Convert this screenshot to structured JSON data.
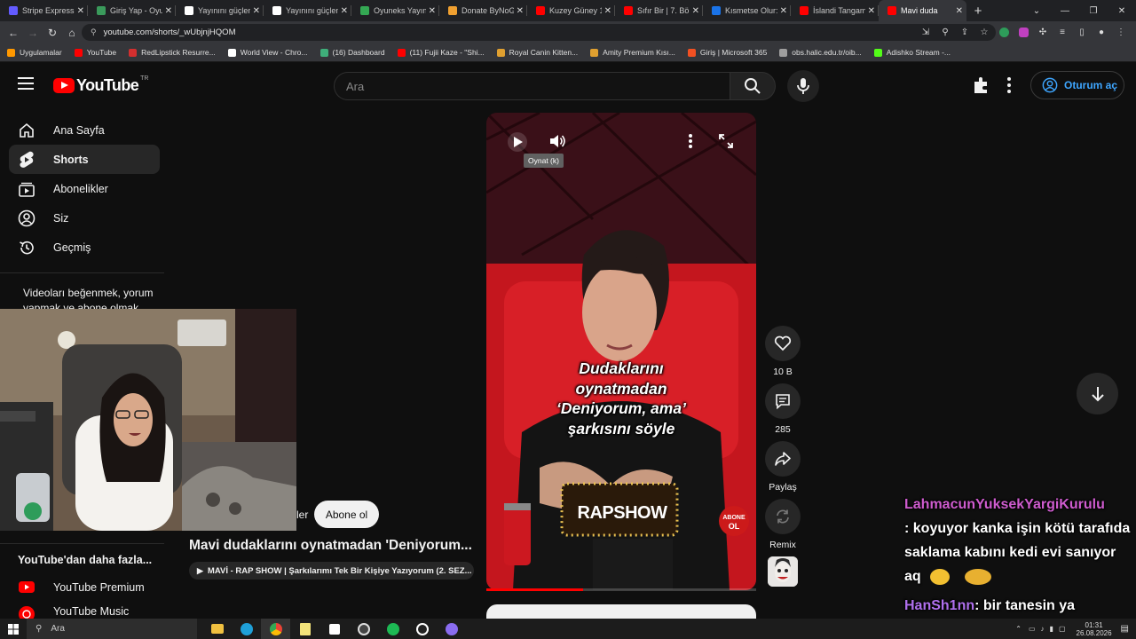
{
  "browser": {
    "tabs": [
      {
        "title": "Stripe Express",
        "color": "#635bff"
      },
      {
        "title": "Giriş Yap - Oyun",
        "color": "#3a9a5b"
      },
      {
        "title": "Yayınını güçlend",
        "color": "#ffffff"
      },
      {
        "title": "Yayınını güçlend",
        "color": "#ffffff"
      },
      {
        "title": "Oyuneks Yayınc",
        "color": "#34a853"
      },
      {
        "title": "Donate ByNoGa",
        "color": "#f0a030"
      },
      {
        "title": "Kuzey Güney 11",
        "color": "#ff0000"
      },
      {
        "title": "Sıfır Bir | 7. Bölü",
        "color": "#ff0000"
      },
      {
        "title": "Kısmetse Olur: A",
        "color": "#1a73e8"
      },
      {
        "title": "İslandi Tangam",
        "color": "#ff0000"
      },
      {
        "title": "Mavi duda",
        "color": "#ff0000",
        "active": true
      }
    ],
    "url": "youtube.com/shorts/_wUbjnjHQOM",
    "bookmarks": [
      {
        "label": "Uygulamalar",
        "color": "#ff9800"
      },
      {
        "label": "YouTube",
        "color": "#ff0000"
      },
      {
        "label": "RedLipstick Resurre...",
        "color": "#d32f2f"
      },
      {
        "label": "World View - Chro...",
        "color": "#ffffff"
      },
      {
        "label": "(16) Dashboard",
        "color": "#3fae7a"
      },
      {
        "label": "(11) Fujii Kaze - \"Shi...",
        "color": "#ff0000"
      },
      {
        "label": "Royal Canin Kitten...",
        "color": "#e0a030"
      },
      {
        "label": "Amity Premium Kısı...",
        "color": "#e0a030"
      },
      {
        "label": "Giriş | Microsoft 365",
        "color": "#f25022"
      },
      {
        "label": "obs.halic.edu.tr/oib...",
        "color": "#9e9e9e"
      },
      {
        "label": "Adishko Stream -...",
        "color": "#53fc18"
      }
    ]
  },
  "yt": {
    "logo_text": "YouTube",
    "region": "TR",
    "search_placeholder": "Ara",
    "signin_label": "Oturum aç",
    "sidebar": [
      {
        "label": "Ana Sayfa",
        "icon": "home-icon"
      },
      {
        "label": "Shorts",
        "icon": "shorts-icon",
        "active": true
      },
      {
        "label": "Abonelikler",
        "icon": "subscriptions-icon"
      },
      {
        "label": "Siz",
        "icon": "you-icon"
      },
      {
        "label": "Geçmiş",
        "icon": "history-icon"
      }
    ],
    "sidebar_note": "Videoları beğenmek, yorum yapmak ve abone olmak için",
    "more_heading": "YouTube'dan daha fazla...",
    "more_items": [
      {
        "label": "YouTube Premium"
      },
      {
        "label": "YouTube Music"
      }
    ]
  },
  "short": {
    "tooltip": "Oynat (k)",
    "caption_lines": [
      "Dudaklarını",
      "oynatmadan",
      "‘Deniyorum, ama’",
      "şarkısını söyle"
    ],
    "sign_text": "RAPSHOW",
    "badge_text": [
      "ABONE",
      "OL"
    ],
    "progress": 0.36,
    "likes": "10 B",
    "comments": "285",
    "share_label": "Paylaş",
    "remix_label": "Remix",
    "subscribe_label": "Abone ol",
    "channel_partial": "ler",
    "title": "Mavi dudaklarını oynatmadan 'Deniyorum...",
    "playlist": "MAVİ - RAP SHOW | Şarkılarımı Tek Bir Kişiye Yazıyorum (2. SEZ..."
  },
  "chat": [
    {
      "user": "LahmacunYuksekYargiKurulu",
      "message": ": koyuyor kanka işin kötü tarafıda saklama kabını kedi evi sanıyor aq"
    },
    {
      "user": "HanSh1nn",
      "message": ": bir tanesin ya"
    }
  ],
  "taskbar": {
    "search_label": "Ara",
    "time": "01:31",
    "date": "26.08.2026"
  }
}
